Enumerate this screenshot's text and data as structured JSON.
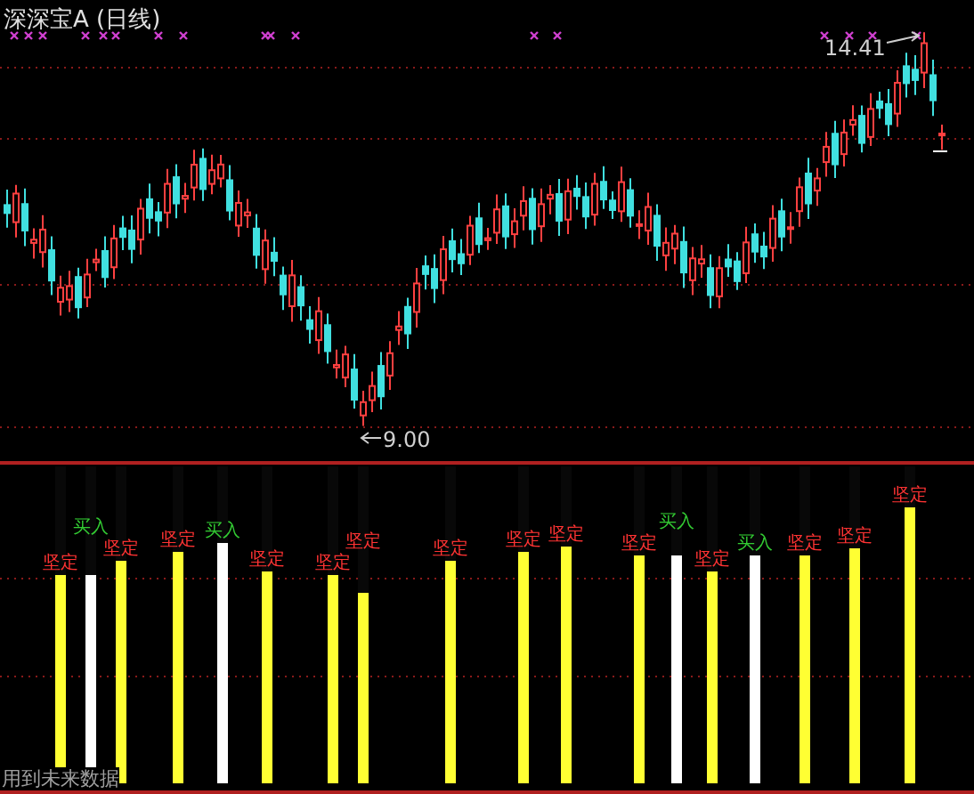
{
  "price_panel": {
    "title": "深深宝A",
    "period": "(日线)",
    "high_label": "14.41",
    "low_label": "9.00"
  },
  "signal_panel": {
    "note": "用到未来数据",
    "bars": [
      {
        "kind": "yellow",
        "level": 0.66,
        "signal": "坚定"
      },
      {
        "kind": "white",
        "level": 0.66,
        "signal": "买入"
      },
      {
        "kind": "yellow",
        "level": 0.7,
        "signal": "坚定"
      },
      {
        "kind": "yellow",
        "level": 0.73,
        "signal": "坚定"
      },
      {
        "kind": "white",
        "level": 0.76,
        "signal": "买入"
      },
      {
        "kind": "yellow",
        "level": 0.67,
        "signal": "坚定"
      },
      {
        "kind": "yellow",
        "level": 0.66,
        "signal": "坚定"
      },
      {
        "kind": "yellow",
        "level": 0.6,
        "signal": "坚定"
      },
      {
        "kind": "yellow",
        "level": 0.7,
        "signal": "坚定"
      },
      {
        "kind": "yellow",
        "level": 0.73,
        "signal": "坚定"
      },
      {
        "kind": "yellow",
        "level": 0.75,
        "signal": "坚定"
      },
      {
        "kind": "yellow",
        "level": 0.72,
        "signal": "坚定"
      },
      {
        "kind": "white",
        "level": 0.72,
        "signal": "买入"
      },
      {
        "kind": "yellow",
        "level": 0.67,
        "signal": "坚定"
      },
      {
        "kind": "white",
        "level": 0.72,
        "signal": "买入"
      },
      {
        "kind": "yellow",
        "level": 0.72,
        "signal": "坚定"
      },
      {
        "kind": "yellow",
        "level": 0.74,
        "signal": "坚定"
      },
      {
        "kind": "yellow",
        "level": 0.87,
        "signal": "坚定"
      }
    ]
  }
}
